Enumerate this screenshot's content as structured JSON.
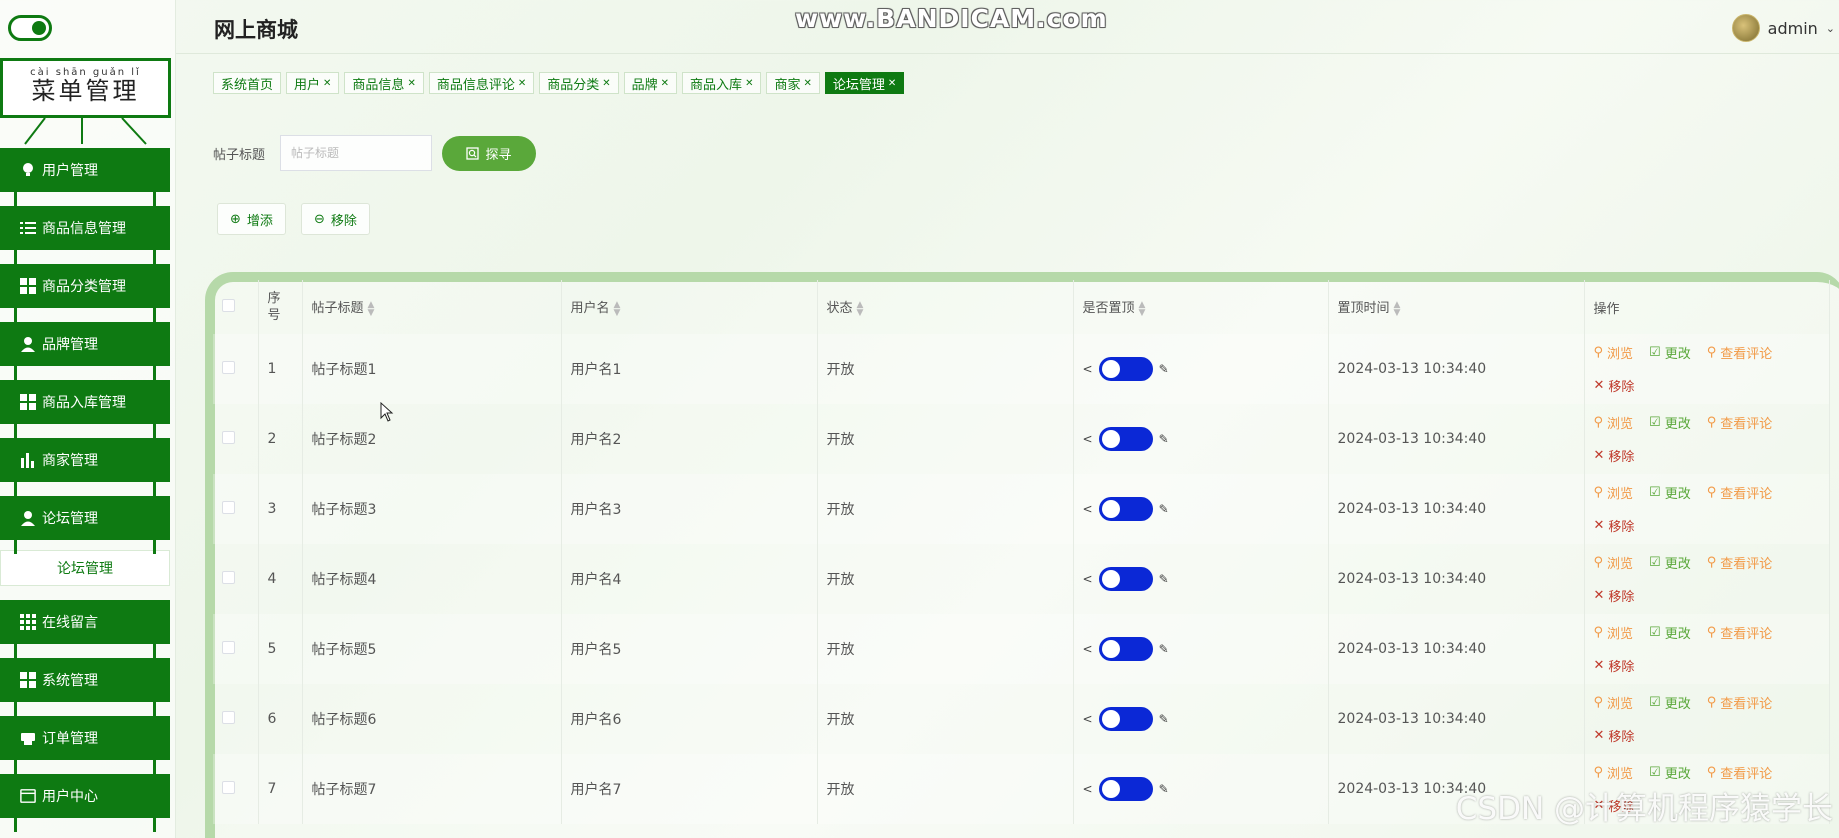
{
  "app": {
    "title": "网上商城",
    "user": "admin",
    "watermark_top": "www.BANDICAM.com",
    "watermark_bottom": "CSDN @计算机程序猿学长"
  },
  "sidebar": {
    "sign_pinyin": "cài shān guǎn lǐ",
    "sign_title": "菜单管理",
    "items": [
      {
        "label": "用户管理",
        "icon": "bulb-icon"
      },
      {
        "label": "商品信息管理",
        "icon": "list-icon"
      },
      {
        "label": "商品分类管理",
        "icon": "grid-icon"
      },
      {
        "label": "品牌管理",
        "icon": "user-icon"
      },
      {
        "label": "商品入库管理",
        "icon": "grid-icon"
      },
      {
        "label": "商家管理",
        "icon": "bar-chart-icon"
      },
      {
        "label": "论坛管理",
        "icon": "user-icon",
        "sub": "论坛管理"
      },
      {
        "label": "在线留言",
        "icon": "apps-icon"
      },
      {
        "label": "系统管理",
        "icon": "grid-icon"
      },
      {
        "label": "订单管理",
        "icon": "printer-icon"
      },
      {
        "label": "用户中心",
        "icon": "card-icon"
      }
    ]
  },
  "tabs": [
    {
      "label": "系统首页",
      "closable": false
    },
    {
      "label": "用户",
      "closable": true
    },
    {
      "label": "商品信息",
      "closable": true
    },
    {
      "label": "商品信息评论",
      "closable": true
    },
    {
      "label": "商品分类",
      "closable": true
    },
    {
      "label": "品牌",
      "closable": true
    },
    {
      "label": "商品入库",
      "closable": true
    },
    {
      "label": "商家",
      "closable": true
    },
    {
      "label": "论坛管理",
      "closable": true,
      "active": true
    }
  ],
  "search": {
    "label": "帖子标题",
    "placeholder": "帖子标题",
    "button": "探寻"
  },
  "actions": {
    "add": "增添",
    "remove": "移除"
  },
  "table": {
    "headers": {
      "index": "序号",
      "title": "帖子标题",
      "username": "用户名",
      "status": "状态",
      "pinned": "是否置顶",
      "pin_time": "置顶时间",
      "ops": "操作"
    },
    "op_labels": {
      "view": "浏览",
      "edit": "更改",
      "comments": "查看评论",
      "delete": "移除"
    },
    "rows": [
      {
        "index": "1",
        "title": "帖子标题1",
        "username": "用户名1",
        "status": "开放",
        "pin_time": "2024-03-13 10:34:40"
      },
      {
        "index": "2",
        "title": "帖子标题2",
        "username": "用户名2",
        "status": "开放",
        "pin_time": "2024-03-13 10:34:40"
      },
      {
        "index": "3",
        "title": "帖子标题3",
        "username": "用户名3",
        "status": "开放",
        "pin_time": "2024-03-13 10:34:40"
      },
      {
        "index": "4",
        "title": "帖子标题4",
        "username": "用户名4",
        "status": "开放",
        "pin_time": "2024-03-13 10:34:40"
      },
      {
        "index": "5",
        "title": "帖子标题5",
        "username": "用户名5",
        "status": "开放",
        "pin_time": "2024-03-13 10:34:40"
      },
      {
        "index": "6",
        "title": "帖子标题6",
        "username": "用户名6",
        "status": "开放",
        "pin_time": "2024-03-13 10:34:40"
      },
      {
        "index": "7",
        "title": "帖子标题7",
        "username": "用户名7",
        "status": "开放",
        "pin_time": "2024-03-13 10:34:40"
      }
    ]
  },
  "colors": {
    "primary": "#0e7a12",
    "switch_on": "#0b28d6",
    "warning": "#f29a47",
    "success": "#5aa83a"
  }
}
